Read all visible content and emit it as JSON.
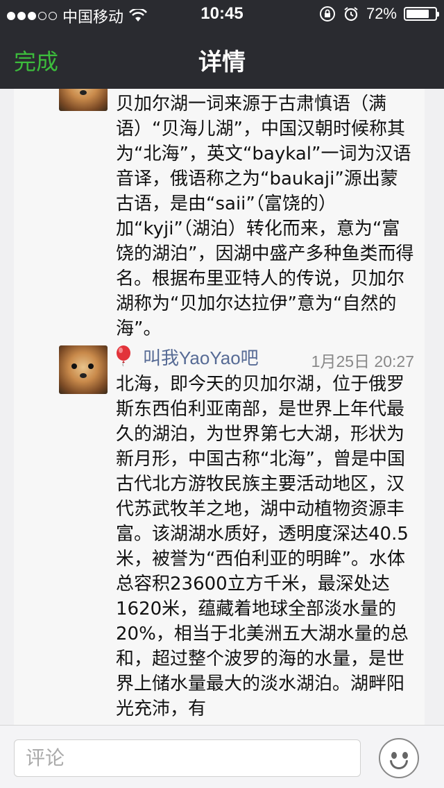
{
  "status_bar": {
    "carrier": "中国移动",
    "time": "10:45",
    "battery": "72%"
  },
  "nav": {
    "done_label": "完成",
    "title": "详情"
  },
  "messages": [
    {
      "text": "贝加尔湖一词来源于古肃慎语（满语）“贝海儿湖”，中国汉朝时候称其为“北海”，英文“baykal”一词为汉语音译，俄语称之为“baukaji”源出蒙古语，是由“saii”（富饶的）加“kyji”（湖泊）转化而来，意为“富饶的湖泊”，因湖中盛产多种鱼类而得名。根据布里亚特人的传说，贝加尔湖称为“贝加尔达拉伊”意为“自然的海”。"
    },
    {
      "sender": "叫我YaoYao吧",
      "timestamp": "1月25日 20:27",
      "text": "北海，即今天的贝加尔湖，位于俄罗斯东西伯利亚南部，是世界上年代最久的湖泊，为世界第七大湖，形状为新月形，中国古称“北海”，曾是中国古代北方游牧民族主要活动地区，汉代苏武牧羊之地，湖中动植物资源丰富。该湖湖水质好，透明度深达40.5米，被誉为“西伯利亚的明眸”。水体总容积23600立方千米，最深处达1620米，蕴藏着地球全部淡水量的20%，相当于北美洲五大湖水量的总和，超过整个波罗的海的水量，是世界上储水量最大的淡水湖泊。湖畔阳光充沛，有"
    }
  ],
  "comment": {
    "placeholder": "评论"
  },
  "colors": {
    "nav_bg": "#2a2b30",
    "done_green": "#3cbc3c",
    "sender_blue": "#576b95"
  }
}
